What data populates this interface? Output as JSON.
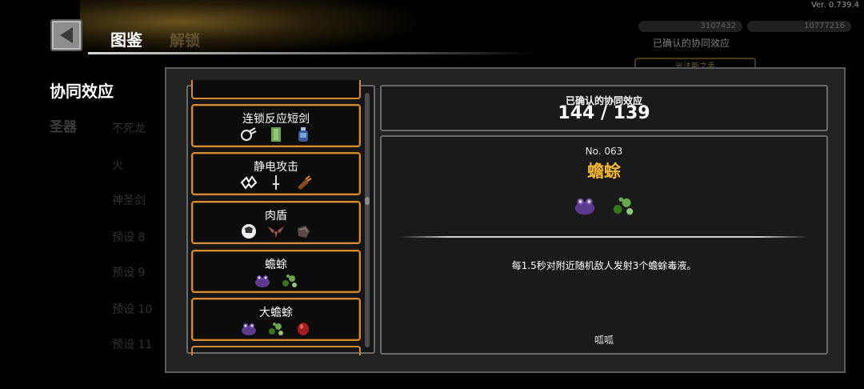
{
  "version": "Ver. 0.739.4",
  "header": {
    "title": "图鉴",
    "unlock_tab": "解锁"
  },
  "currency": [
    "3107432",
    "10777216"
  ],
  "background_labels": {
    "confirmed": "已确认的协同效应",
    "box": "光法斯之手"
  },
  "sidebar": {
    "active": "协同效应",
    "items": [
      {
        "label": "圣器",
        "kind": "cat"
      },
      {
        "label": "不死龙",
        "kind": "item"
      },
      {
        "label": "火",
        "kind": "item"
      },
      {
        "label": "神圣剑",
        "kind": "item"
      },
      {
        "label": "预设 8",
        "kind": "item"
      },
      {
        "label": "预设 9",
        "kind": "item"
      },
      {
        "label": "预设 10",
        "kind": "item"
      },
      {
        "label": "预设 11",
        "kind": "item"
      }
    ]
  },
  "synergy_list": [
    {
      "name": "连锁反应短剑",
      "icons": [
        "chain-icon",
        "green-cloak-icon",
        "blue-potion-icon"
      ]
    },
    {
      "name": "静电攻击",
      "icons": [
        "spark-icon",
        "dagger-icon",
        "claw-icon"
      ]
    },
    {
      "name": "肉盾",
      "icons": [
        "ball-icon",
        "bat-icon",
        "stone-icon"
      ]
    },
    {
      "name": "蟾蜍",
      "icons": [
        "toad-icon",
        "poison-bubbles-icon"
      ]
    },
    {
      "name": "大蟾蜍",
      "icons": [
        "toad-icon",
        "poison-bubbles-icon",
        "red-egg-icon"
      ]
    }
  ],
  "counter": {
    "label": "已确认的协同效应",
    "value": "144 / 139"
  },
  "detail": {
    "number": "No. 063",
    "title": "蟾蜍",
    "icons": [
      "toad-icon",
      "poison-bubbles-icon"
    ],
    "description": "每1.5秒对附近随机敌人发射3个蟾蜍毒液。",
    "sound": "呱呱"
  },
  "colors": {
    "accent_orange": "#d58a2e",
    "title_gold": "#f2b632",
    "panel": "#222222"
  }
}
